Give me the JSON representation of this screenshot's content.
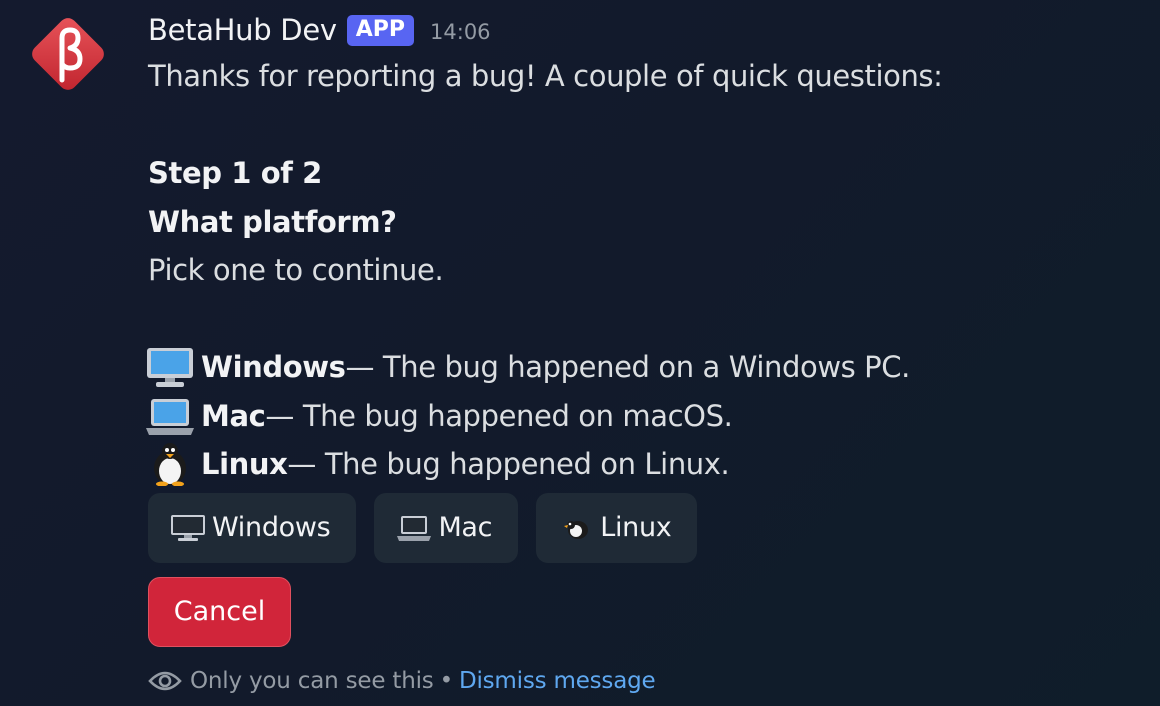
{
  "message": {
    "author": "BetaHub Dev",
    "badge": "APP",
    "timestamp": "14:06",
    "intro": "Thanks for reporting a bug! A couple of quick questions:",
    "step": "Step 1 of 2",
    "question": "What platform?",
    "instruction": "Pick one to continue.",
    "options": [
      {
        "name": "Windows",
        "description": " — The bug happened on a Windows PC."
      },
      {
        "name": "Mac",
        "description": " — The bug happened on macOS."
      },
      {
        "name": "Linux",
        "description": " — The bug happened on Linux."
      }
    ]
  },
  "buttons": {
    "windows": "Windows",
    "mac": "Mac",
    "linux": "Linux",
    "cancel": "Cancel"
  },
  "footer": {
    "visibility": "Only you can see this",
    "separator": "•",
    "dismiss": "Dismiss message"
  },
  "colors": {
    "badge": "#5865f2",
    "cancel": "#d1253a",
    "link": "#5fa8f0",
    "avatar": "#d9363e"
  },
  "icons": {
    "avatar": "betahub-beta-logo",
    "windows": "desktop-computer-icon",
    "mac": "laptop-icon",
    "linux": "penguin-icon",
    "footer": "eye-icon"
  }
}
